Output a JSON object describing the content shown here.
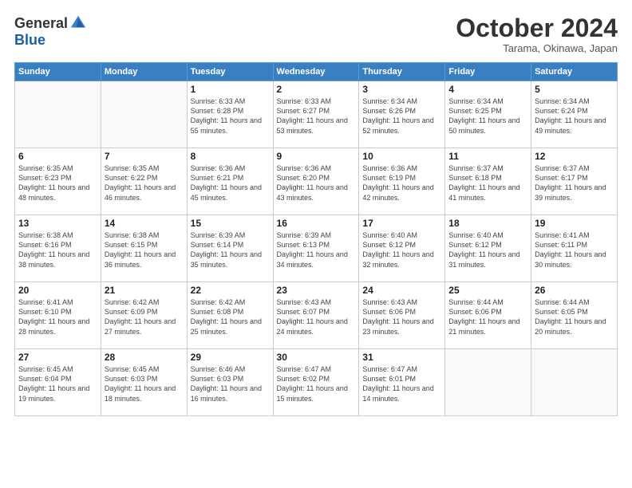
{
  "logo": {
    "general": "General",
    "blue": "Blue"
  },
  "title": "October 2024",
  "location": "Tarama, Okinawa, Japan",
  "days_of_week": [
    "Sunday",
    "Monday",
    "Tuesday",
    "Wednesday",
    "Thursday",
    "Friday",
    "Saturday"
  ],
  "weeks": [
    [
      {
        "day": "",
        "info": ""
      },
      {
        "day": "",
        "info": ""
      },
      {
        "day": "1",
        "info": "Sunrise: 6:33 AM\nSunset: 6:28 PM\nDaylight: 11 hours and 55 minutes."
      },
      {
        "day": "2",
        "info": "Sunrise: 6:33 AM\nSunset: 6:27 PM\nDaylight: 11 hours and 53 minutes."
      },
      {
        "day": "3",
        "info": "Sunrise: 6:34 AM\nSunset: 6:26 PM\nDaylight: 11 hours and 52 minutes."
      },
      {
        "day": "4",
        "info": "Sunrise: 6:34 AM\nSunset: 6:25 PM\nDaylight: 11 hours and 50 minutes."
      },
      {
        "day": "5",
        "info": "Sunrise: 6:34 AM\nSunset: 6:24 PM\nDaylight: 11 hours and 49 minutes."
      }
    ],
    [
      {
        "day": "6",
        "info": "Sunrise: 6:35 AM\nSunset: 6:23 PM\nDaylight: 11 hours and 48 minutes."
      },
      {
        "day": "7",
        "info": "Sunrise: 6:35 AM\nSunset: 6:22 PM\nDaylight: 11 hours and 46 minutes."
      },
      {
        "day": "8",
        "info": "Sunrise: 6:36 AM\nSunset: 6:21 PM\nDaylight: 11 hours and 45 minutes."
      },
      {
        "day": "9",
        "info": "Sunrise: 6:36 AM\nSunset: 6:20 PM\nDaylight: 11 hours and 43 minutes."
      },
      {
        "day": "10",
        "info": "Sunrise: 6:36 AM\nSunset: 6:19 PM\nDaylight: 11 hours and 42 minutes."
      },
      {
        "day": "11",
        "info": "Sunrise: 6:37 AM\nSunset: 6:18 PM\nDaylight: 11 hours and 41 minutes."
      },
      {
        "day": "12",
        "info": "Sunrise: 6:37 AM\nSunset: 6:17 PM\nDaylight: 11 hours and 39 minutes."
      }
    ],
    [
      {
        "day": "13",
        "info": "Sunrise: 6:38 AM\nSunset: 6:16 PM\nDaylight: 11 hours and 38 minutes."
      },
      {
        "day": "14",
        "info": "Sunrise: 6:38 AM\nSunset: 6:15 PM\nDaylight: 11 hours and 36 minutes."
      },
      {
        "day": "15",
        "info": "Sunrise: 6:39 AM\nSunset: 6:14 PM\nDaylight: 11 hours and 35 minutes."
      },
      {
        "day": "16",
        "info": "Sunrise: 6:39 AM\nSunset: 6:13 PM\nDaylight: 11 hours and 34 minutes."
      },
      {
        "day": "17",
        "info": "Sunrise: 6:40 AM\nSunset: 6:12 PM\nDaylight: 11 hours and 32 minutes."
      },
      {
        "day": "18",
        "info": "Sunrise: 6:40 AM\nSunset: 6:12 PM\nDaylight: 11 hours and 31 minutes."
      },
      {
        "day": "19",
        "info": "Sunrise: 6:41 AM\nSunset: 6:11 PM\nDaylight: 11 hours and 30 minutes."
      }
    ],
    [
      {
        "day": "20",
        "info": "Sunrise: 6:41 AM\nSunset: 6:10 PM\nDaylight: 11 hours and 28 minutes."
      },
      {
        "day": "21",
        "info": "Sunrise: 6:42 AM\nSunset: 6:09 PM\nDaylight: 11 hours and 27 minutes."
      },
      {
        "day": "22",
        "info": "Sunrise: 6:42 AM\nSunset: 6:08 PM\nDaylight: 11 hours and 25 minutes."
      },
      {
        "day": "23",
        "info": "Sunrise: 6:43 AM\nSunset: 6:07 PM\nDaylight: 11 hours and 24 minutes."
      },
      {
        "day": "24",
        "info": "Sunrise: 6:43 AM\nSunset: 6:06 PM\nDaylight: 11 hours and 23 minutes."
      },
      {
        "day": "25",
        "info": "Sunrise: 6:44 AM\nSunset: 6:06 PM\nDaylight: 11 hours and 21 minutes."
      },
      {
        "day": "26",
        "info": "Sunrise: 6:44 AM\nSunset: 6:05 PM\nDaylight: 11 hours and 20 minutes."
      }
    ],
    [
      {
        "day": "27",
        "info": "Sunrise: 6:45 AM\nSunset: 6:04 PM\nDaylight: 11 hours and 19 minutes."
      },
      {
        "day": "28",
        "info": "Sunrise: 6:45 AM\nSunset: 6:03 PM\nDaylight: 11 hours and 18 minutes."
      },
      {
        "day": "29",
        "info": "Sunrise: 6:46 AM\nSunset: 6:03 PM\nDaylight: 11 hours and 16 minutes."
      },
      {
        "day": "30",
        "info": "Sunrise: 6:47 AM\nSunset: 6:02 PM\nDaylight: 11 hours and 15 minutes."
      },
      {
        "day": "31",
        "info": "Sunrise: 6:47 AM\nSunset: 6:01 PM\nDaylight: 11 hours and 14 minutes."
      },
      {
        "day": "",
        "info": ""
      },
      {
        "day": "",
        "info": ""
      }
    ]
  ]
}
